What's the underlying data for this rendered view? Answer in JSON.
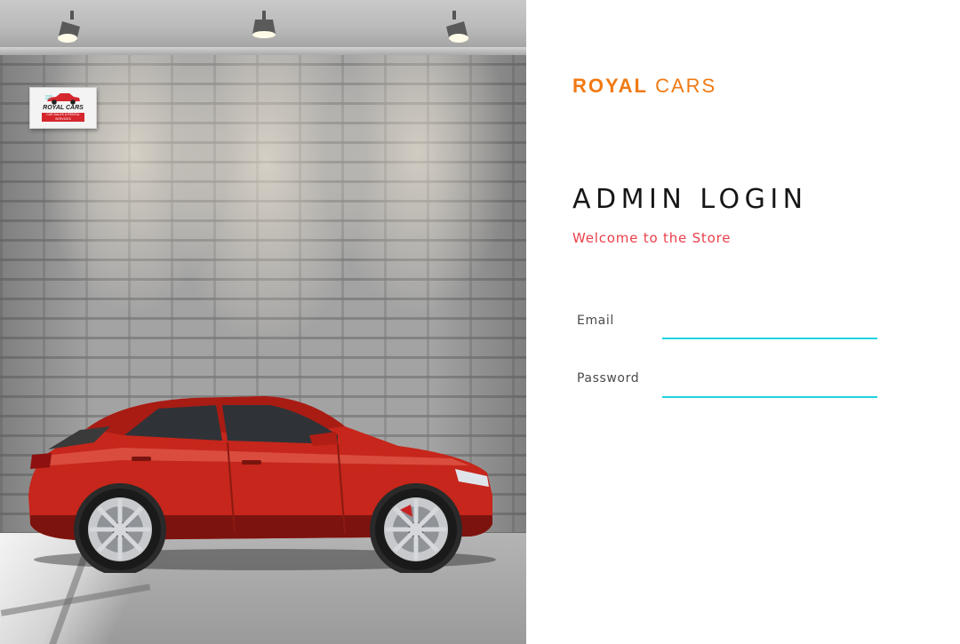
{
  "brand": {
    "first": "ROYAL",
    "second": "CARS",
    "color": "#f07a14"
  },
  "login": {
    "title": "ADMIN LOGIN",
    "subtitle": "Welcome to the Store",
    "subtitle_color": "#ea3f4a",
    "accent_color": "#1fd3df"
  },
  "form": {
    "email_label": "Email",
    "email_value": "",
    "password_label": "Password",
    "password_value": ""
  },
  "hero": {
    "sign_name": "ROYAL CARS",
    "sign_tagline": "CAR SALES & RENTAL SERVICES",
    "car_color": "#c6261b"
  }
}
